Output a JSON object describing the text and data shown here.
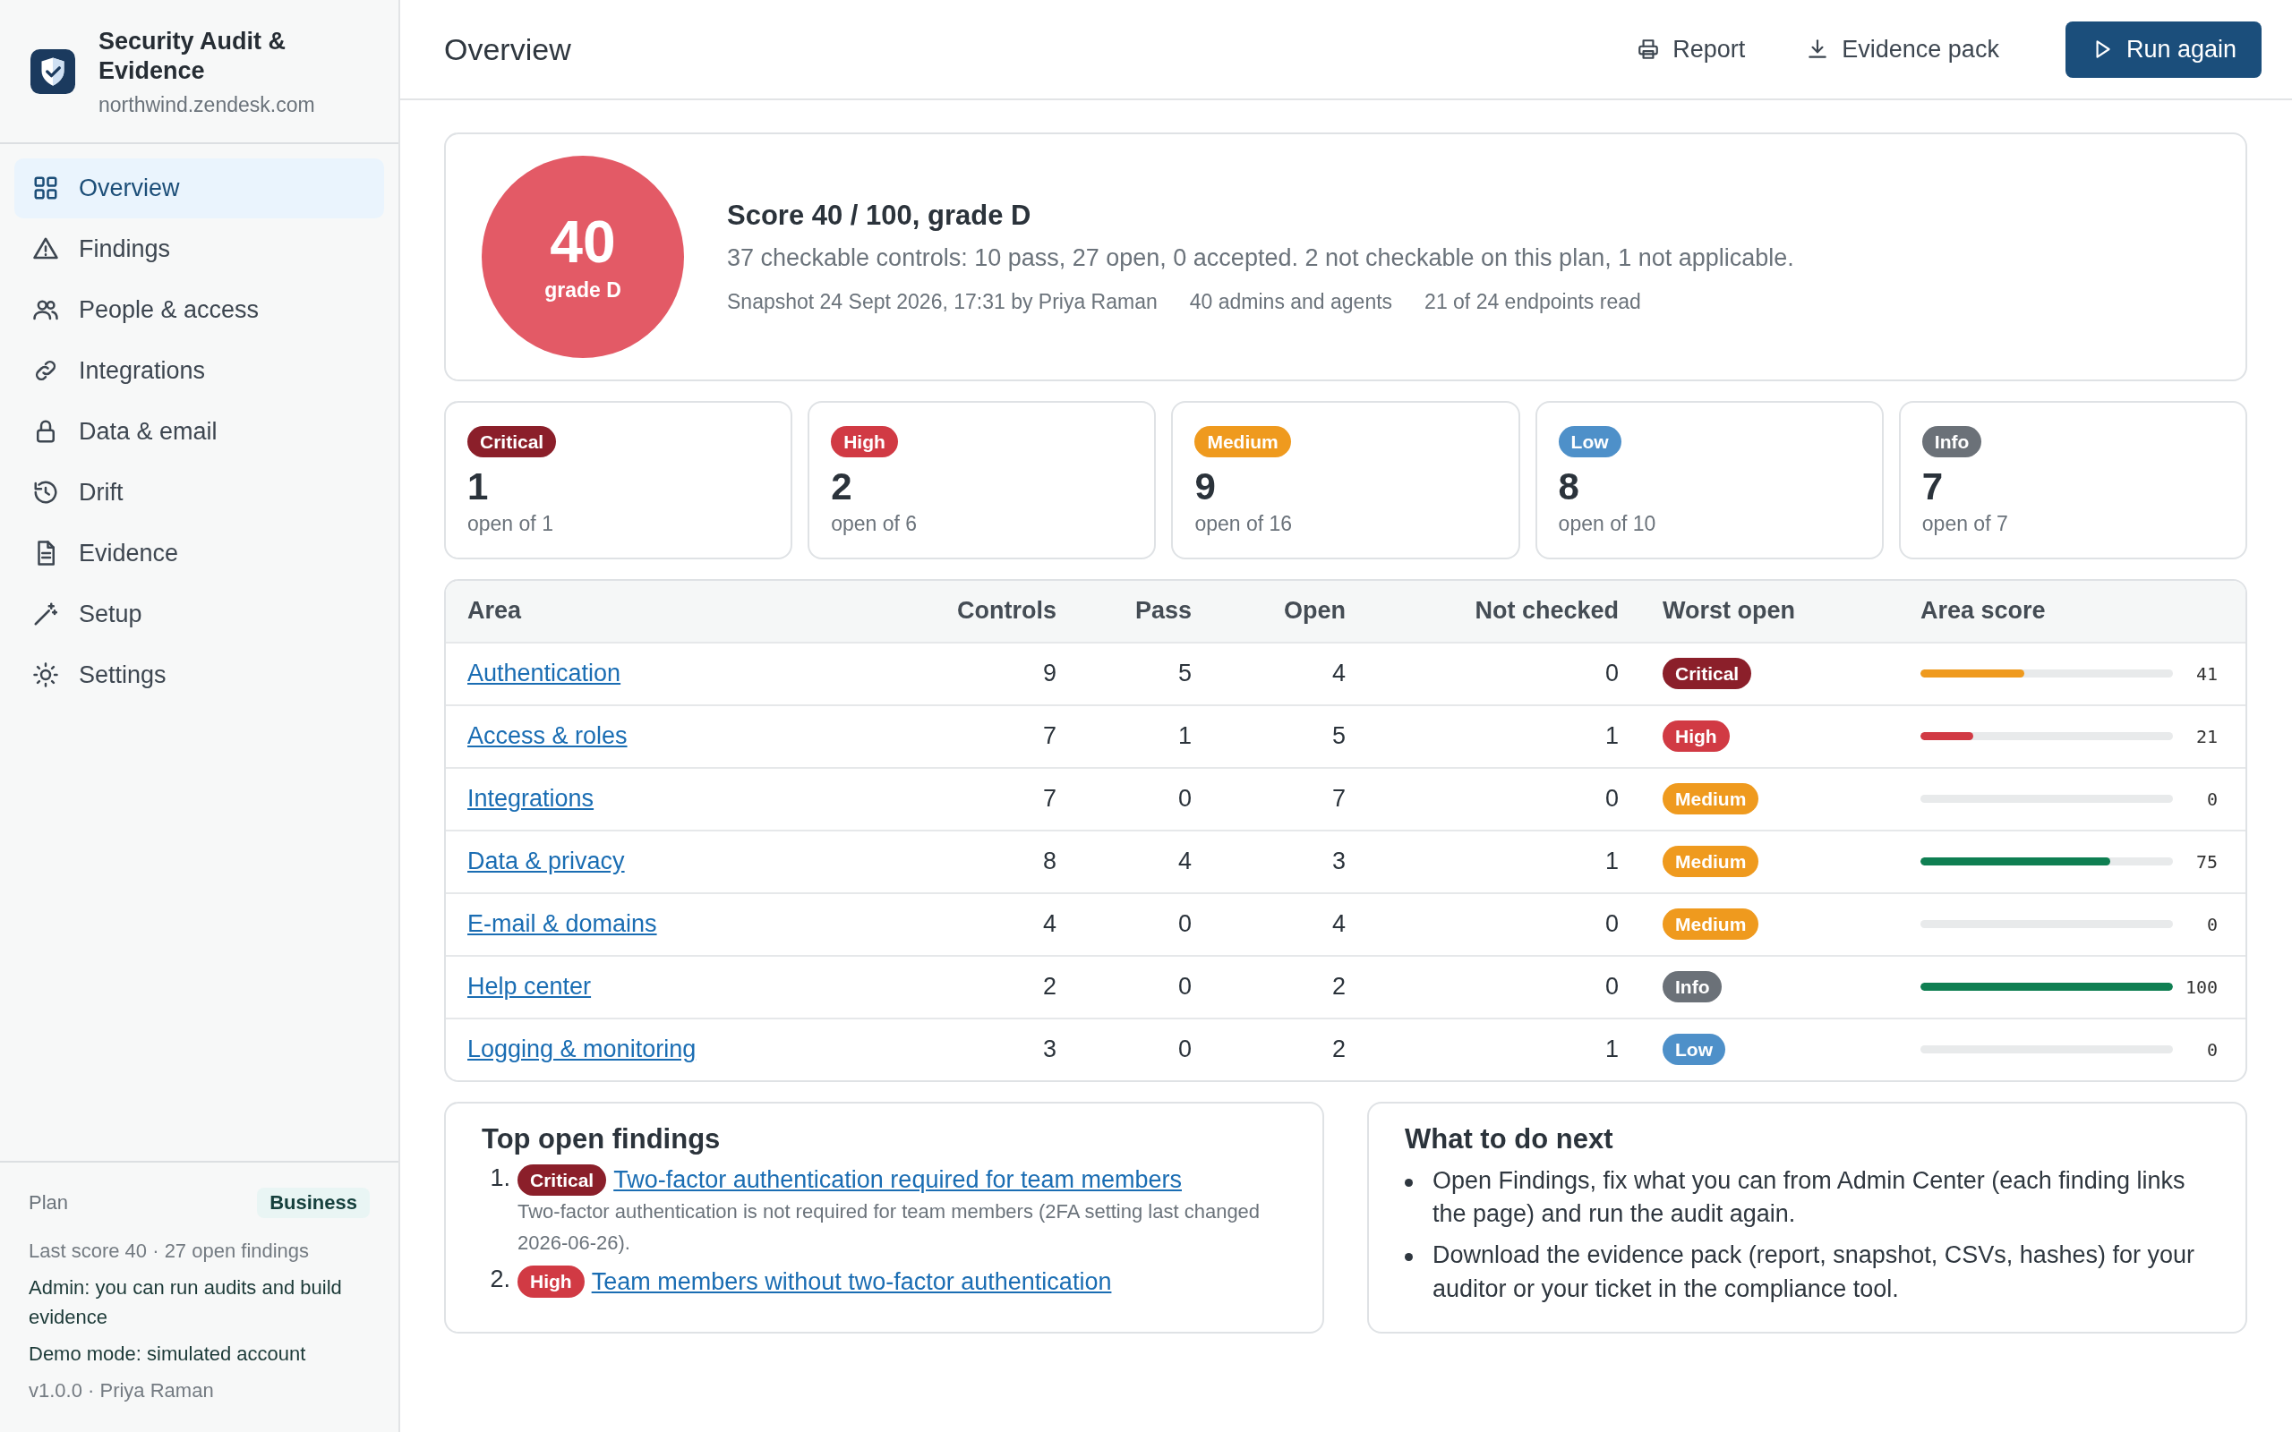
{
  "sidebar": {
    "app_title": "Security Audit & Evidence",
    "subdomain": "northwind.zendesk.com",
    "items": [
      {
        "label": "Overview",
        "selected": true
      },
      {
        "label": "Findings",
        "selected": false
      },
      {
        "label": "People & access",
        "selected": false
      },
      {
        "label": "Integrations",
        "selected": false
      },
      {
        "label": "Data & email",
        "selected": false
      },
      {
        "label": "Drift",
        "selected": false
      },
      {
        "label": "Evidence",
        "selected": false
      },
      {
        "label": "Setup",
        "selected": false
      },
      {
        "label": "Settings",
        "selected": false
      }
    ],
    "footer": {
      "plan_label": "Plan",
      "plan": "Business",
      "lines": [
        {
          "text": "Last score 40 · 27 open findings",
          "kind": "muted"
        },
        {
          "text": "Admin: you can run audits and build evidence",
          "kind": "note"
        },
        {
          "text": "Demo mode: simulated account",
          "kind": "note"
        },
        {
          "text": "v1.0.0 · Priya Raman",
          "kind": "muted"
        }
      ]
    }
  },
  "header": {
    "title": "Overview",
    "actions": [
      {
        "label": "Report",
        "kind": "print"
      },
      {
        "label": "Evidence pack",
        "kind": "download"
      },
      {
        "label": "Run again",
        "kind": "primary"
      }
    ]
  },
  "score": {
    "value": "40",
    "grade": "grade D",
    "title": "Score 40 / 100, grade D",
    "summary": "37 checkable controls: 10 pass, 27 open, 0 accepted. 2 not checkable on this plan, 1 not applicable.",
    "meta": [
      "Snapshot 24 Sept 2026, 17:31 by Priya Raman",
      "40 admins and agents",
      "21 of 24 endpoints read"
    ]
  },
  "severity_cards": [
    {
      "label": "Critical",
      "kind": "critical",
      "count": "1",
      "detail": "open of 1"
    },
    {
      "label": "High",
      "kind": "high",
      "count": "2",
      "detail": "open of 6"
    },
    {
      "label": "Medium",
      "kind": "medium",
      "count": "9",
      "detail": "open of 16"
    },
    {
      "label": "Low",
      "kind": "low",
      "count": "8",
      "detail": "open of 10"
    },
    {
      "label": "Info",
      "kind": "info",
      "count": "7",
      "detail": "open of 7"
    }
  ],
  "table": {
    "columns": [
      "Area",
      "Controls",
      "Pass",
      "Open",
      "Not checked",
      "Worst open",
      "Area score"
    ],
    "rows": [
      {
        "area": "Authentication",
        "controls": "9",
        "pass": "5",
        "open": "4",
        "not_checked": "0",
        "worst_open": {
          "label": "Critical",
          "kind": "critical"
        },
        "area_score": {
          "level": 0.41,
          "reading": "41"
        }
      },
      {
        "area": "Access & roles",
        "controls": "7",
        "pass": "1",
        "open": "5",
        "not_checked": "1",
        "worst_open": {
          "label": "High",
          "kind": "high"
        },
        "area_score": {
          "level": 0.21,
          "reading": "21"
        }
      },
      {
        "area": "Integrations",
        "controls": "7",
        "pass": "0",
        "open": "7",
        "not_checked": "0",
        "worst_open": {
          "label": "Medium",
          "kind": "medium"
        },
        "area_score": {
          "level": 0,
          "reading": "0"
        }
      },
      {
        "area": "Data & privacy",
        "controls": "8",
        "pass": "4",
        "open": "3",
        "not_checked": "1",
        "worst_open": {
          "label": "Medium",
          "kind": "medium"
        },
        "area_score": {
          "level": 0.75,
          "reading": "75"
        }
      },
      {
        "area": "E-mail & domains",
        "controls": "4",
        "pass": "0",
        "open": "4",
        "not_checked": "0",
        "worst_open": {
          "label": "Medium",
          "kind": "medium"
        },
        "area_score": {
          "level": 0,
          "reading": "0"
        }
      },
      {
        "area": "Help center",
        "controls": "2",
        "pass": "0",
        "open": "2",
        "not_checked": "0",
        "worst_open": {
          "label": "Info",
          "kind": "info"
        },
        "area_score": {
          "level": 1,
          "reading": "100"
        }
      },
      {
        "area": "Logging & monitoring",
        "controls": "3",
        "pass": "0",
        "open": "2",
        "not_checked": "1",
        "worst_open": {
          "label": "Low",
          "kind": "low"
        },
        "area_score": {
          "level": 0,
          "reading": "0"
        }
      }
    ]
  },
  "top_findings": {
    "title": "Top open findings",
    "items": [
      {
        "number": "1.",
        "severity": {
          "label": "Critical",
          "kind": "critical"
        },
        "title": "Two-factor authentication required for team members",
        "description": "Two-factor authentication is not required for team members (2FA setting last changed 2026-06-26)."
      },
      {
        "number": "2.",
        "severity": {
          "label": "High",
          "kind": "high"
        },
        "title": "Team members without two-factor authentication"
      }
    ]
  },
  "next_steps": {
    "title": "What to do next",
    "items": [
      "Open Findings, fix what you can from Admin Center (each finding links the page) and run the audit again.",
      "Download the evidence pack (report, snapshot, CSVs, hashes) for your auditor or your ticket in the compliance tool."
    ]
  }
}
